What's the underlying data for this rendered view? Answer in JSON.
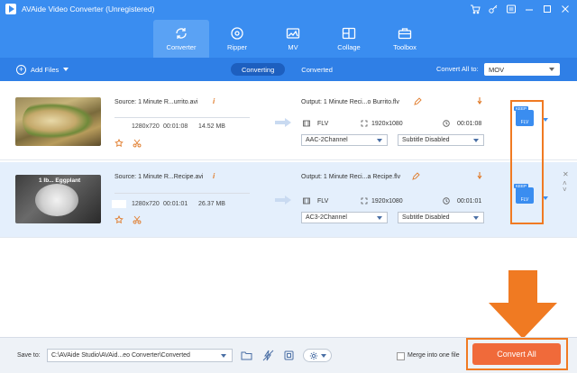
{
  "window": {
    "title": "AVAide Video Converter (Unregistered)",
    "controls": [
      "cart-icon",
      "key-icon",
      "menu-icon",
      "minimize-icon",
      "maximize-icon",
      "close-icon"
    ]
  },
  "nav": {
    "tabs": [
      {
        "label": "Converter",
        "icon": "converter-icon",
        "active": true
      },
      {
        "label": "Ripper",
        "icon": "ripper-icon",
        "active": false
      },
      {
        "label": "MV",
        "icon": "mv-icon",
        "active": false
      },
      {
        "label": "Collage",
        "icon": "collage-icon",
        "active": false
      },
      {
        "label": "Toolbox",
        "icon": "toolbox-icon",
        "active": false
      }
    ]
  },
  "toolbar": {
    "add_files_label": "Add Files",
    "subtabs": [
      {
        "label": "Converting",
        "active": true
      },
      {
        "label": "Converted",
        "active": false
      }
    ],
    "convert_all_to_label": "Convert All to:",
    "convert_all_format": "MOV"
  },
  "files": [
    {
      "thumb_label": "",
      "source": "Source: 1 Minute R...urrito.avi",
      "resolution": "1280x720",
      "duration": "00:01:08",
      "size": "14.52 MB",
      "output": "Output: 1 Minute Reci...o Burrito.flv",
      "out_format": "FLV",
      "out_resolution": "1920x1080",
      "out_duration": "00:01:08",
      "audio": "AAC-2Channel",
      "subtitle": "Subtitle Disabled",
      "chip_keep": "KEEP",
      "chip_format": "FLV"
    },
    {
      "thumb_label": "1 Ib... Eggplant",
      "source": "Source: 1 Minute R...Recipe.avi",
      "resolution": "1280x720",
      "duration": "00:01:01",
      "size": "26.37 MB",
      "output": "Output: 1 Minute Reci...a Recipe.flv",
      "out_format": "FLV",
      "out_resolution": "1920x1080",
      "out_duration": "00:01:01",
      "audio": "AC3-2Channel",
      "subtitle": "Subtitle Disabled",
      "chip_keep": "KEEP",
      "chip_format": "FLV"
    }
  ],
  "bottom": {
    "save_to_label": "Save to:",
    "save_path": "C:\\AVAide Studio\\AVAid...eo Converter\\Converted",
    "merge_label": "Merge into one file",
    "convert_all_label": "Convert All"
  },
  "colors": {
    "header": "#3a8df0",
    "toolbar": "#2f7fe6",
    "highlight": "#f07a22",
    "convert_button": "#f06a3a",
    "selected_row": "#e4effc"
  }
}
